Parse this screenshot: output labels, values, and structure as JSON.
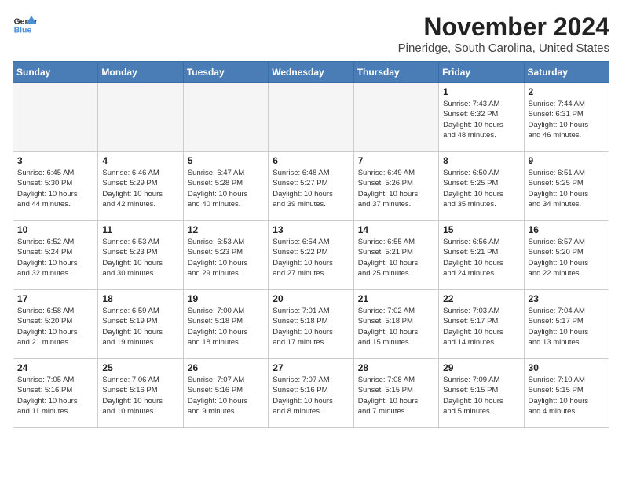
{
  "logo": {
    "line1": "General",
    "line2": "Blue"
  },
  "title": "November 2024",
  "location": "Pineridge, South Carolina, United States",
  "days_of_week": [
    "Sunday",
    "Monday",
    "Tuesday",
    "Wednesday",
    "Thursday",
    "Friday",
    "Saturday"
  ],
  "weeks": [
    [
      {
        "day": "",
        "info": "",
        "empty": true
      },
      {
        "day": "",
        "info": "",
        "empty": true
      },
      {
        "day": "",
        "info": "",
        "empty": true
      },
      {
        "day": "",
        "info": "",
        "empty": true
      },
      {
        "day": "",
        "info": "",
        "empty": true
      },
      {
        "day": "1",
        "info": "Sunrise: 7:43 AM\nSunset: 6:32 PM\nDaylight: 10 hours\nand 48 minutes."
      },
      {
        "day": "2",
        "info": "Sunrise: 7:44 AM\nSunset: 6:31 PM\nDaylight: 10 hours\nand 46 minutes."
      }
    ],
    [
      {
        "day": "3",
        "info": "Sunrise: 6:45 AM\nSunset: 5:30 PM\nDaylight: 10 hours\nand 44 minutes."
      },
      {
        "day": "4",
        "info": "Sunrise: 6:46 AM\nSunset: 5:29 PM\nDaylight: 10 hours\nand 42 minutes."
      },
      {
        "day": "5",
        "info": "Sunrise: 6:47 AM\nSunset: 5:28 PM\nDaylight: 10 hours\nand 40 minutes."
      },
      {
        "day": "6",
        "info": "Sunrise: 6:48 AM\nSunset: 5:27 PM\nDaylight: 10 hours\nand 39 minutes."
      },
      {
        "day": "7",
        "info": "Sunrise: 6:49 AM\nSunset: 5:26 PM\nDaylight: 10 hours\nand 37 minutes."
      },
      {
        "day": "8",
        "info": "Sunrise: 6:50 AM\nSunset: 5:25 PM\nDaylight: 10 hours\nand 35 minutes."
      },
      {
        "day": "9",
        "info": "Sunrise: 6:51 AM\nSunset: 5:25 PM\nDaylight: 10 hours\nand 34 minutes."
      }
    ],
    [
      {
        "day": "10",
        "info": "Sunrise: 6:52 AM\nSunset: 5:24 PM\nDaylight: 10 hours\nand 32 minutes."
      },
      {
        "day": "11",
        "info": "Sunrise: 6:53 AM\nSunset: 5:23 PM\nDaylight: 10 hours\nand 30 minutes."
      },
      {
        "day": "12",
        "info": "Sunrise: 6:53 AM\nSunset: 5:23 PM\nDaylight: 10 hours\nand 29 minutes."
      },
      {
        "day": "13",
        "info": "Sunrise: 6:54 AM\nSunset: 5:22 PM\nDaylight: 10 hours\nand 27 minutes."
      },
      {
        "day": "14",
        "info": "Sunrise: 6:55 AM\nSunset: 5:21 PM\nDaylight: 10 hours\nand 25 minutes."
      },
      {
        "day": "15",
        "info": "Sunrise: 6:56 AM\nSunset: 5:21 PM\nDaylight: 10 hours\nand 24 minutes."
      },
      {
        "day": "16",
        "info": "Sunrise: 6:57 AM\nSunset: 5:20 PM\nDaylight: 10 hours\nand 22 minutes."
      }
    ],
    [
      {
        "day": "17",
        "info": "Sunrise: 6:58 AM\nSunset: 5:20 PM\nDaylight: 10 hours\nand 21 minutes."
      },
      {
        "day": "18",
        "info": "Sunrise: 6:59 AM\nSunset: 5:19 PM\nDaylight: 10 hours\nand 19 minutes."
      },
      {
        "day": "19",
        "info": "Sunrise: 7:00 AM\nSunset: 5:18 PM\nDaylight: 10 hours\nand 18 minutes."
      },
      {
        "day": "20",
        "info": "Sunrise: 7:01 AM\nSunset: 5:18 PM\nDaylight: 10 hours\nand 17 minutes."
      },
      {
        "day": "21",
        "info": "Sunrise: 7:02 AM\nSunset: 5:18 PM\nDaylight: 10 hours\nand 15 minutes."
      },
      {
        "day": "22",
        "info": "Sunrise: 7:03 AM\nSunset: 5:17 PM\nDaylight: 10 hours\nand 14 minutes."
      },
      {
        "day": "23",
        "info": "Sunrise: 7:04 AM\nSunset: 5:17 PM\nDaylight: 10 hours\nand 13 minutes."
      }
    ],
    [
      {
        "day": "24",
        "info": "Sunrise: 7:05 AM\nSunset: 5:16 PM\nDaylight: 10 hours\nand 11 minutes."
      },
      {
        "day": "25",
        "info": "Sunrise: 7:06 AM\nSunset: 5:16 PM\nDaylight: 10 hours\nand 10 minutes."
      },
      {
        "day": "26",
        "info": "Sunrise: 7:07 AM\nSunset: 5:16 PM\nDaylight: 10 hours\nand 9 minutes."
      },
      {
        "day": "27",
        "info": "Sunrise: 7:07 AM\nSunset: 5:16 PM\nDaylight: 10 hours\nand 8 minutes."
      },
      {
        "day": "28",
        "info": "Sunrise: 7:08 AM\nSunset: 5:15 PM\nDaylight: 10 hours\nand 7 minutes."
      },
      {
        "day": "29",
        "info": "Sunrise: 7:09 AM\nSunset: 5:15 PM\nDaylight: 10 hours\nand 5 minutes."
      },
      {
        "day": "30",
        "info": "Sunrise: 7:10 AM\nSunset: 5:15 PM\nDaylight: 10 hours\nand 4 minutes."
      }
    ]
  ]
}
